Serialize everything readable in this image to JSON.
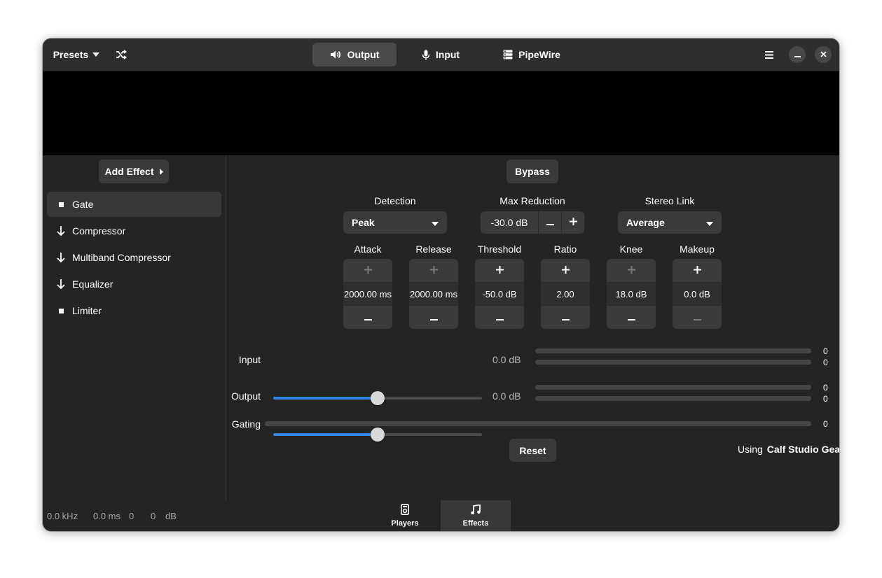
{
  "header": {
    "presets_label": "Presets",
    "tabs": [
      {
        "label": "Output",
        "icon": "speaker-icon",
        "active": true
      },
      {
        "label": "Input",
        "icon": "microphone-icon",
        "active": false
      },
      {
        "label": "PipeWire",
        "icon": "server-icon",
        "active": false
      }
    ]
  },
  "sidebar": {
    "add_effect_label": "Add Effect",
    "effects": [
      {
        "label": "Gate",
        "icon": "square-icon",
        "selected": true
      },
      {
        "label": "Compressor",
        "icon": "arrow-down-icon"
      },
      {
        "label": "Multiband Compressor",
        "icon": "arrow-down-icon"
      },
      {
        "label": "Equalizer",
        "icon": "arrow-down-icon"
      },
      {
        "label": "Limiter",
        "icon": "square-icon"
      }
    ]
  },
  "gate": {
    "bypass_label": "Bypass",
    "detection": {
      "label": "Detection",
      "value": "Peak"
    },
    "max_reduction": {
      "label": "Max Reduction",
      "value": "-30.0 dB"
    },
    "stereo_link": {
      "label": "Stereo Link",
      "value": "Average"
    },
    "controls": [
      {
        "label": "Attack",
        "value": "2000.00 ms",
        "plus_enabled": false,
        "minus_enabled": true
      },
      {
        "label": "Release",
        "value": "2000.00 ms",
        "plus_enabled": false,
        "minus_enabled": true
      },
      {
        "label": "Threshold",
        "value": "-50.0 dB",
        "plus_enabled": true,
        "minus_enabled": true
      },
      {
        "label": "Ratio",
        "value": "2.00",
        "plus_enabled": true,
        "minus_enabled": true
      },
      {
        "label": "Knee",
        "value": "18.0 dB",
        "plus_enabled": false,
        "minus_enabled": true
      },
      {
        "label": "Makeup",
        "value": "0.0 dB",
        "plus_enabled": true,
        "minus_enabled": false
      }
    ],
    "input": {
      "label": "Input",
      "gain": "0.0 dB",
      "slider_fraction": 0.5,
      "levels": [
        "0",
        "0"
      ]
    },
    "output": {
      "label": "Output",
      "gain": "0.0 dB",
      "slider_fraction": 0.5,
      "levels": [
        "0",
        "0"
      ]
    },
    "gating": {
      "label": "Gating",
      "value": "0"
    },
    "reset_label": "Reset",
    "using_prefix": "Using",
    "using_name": "Calf Studio Gear"
  },
  "status": {
    "rate": "0.0 kHz",
    "latency": "0.0 ms",
    "v1": "0",
    "v2": "0",
    "unit": "dB"
  },
  "bottom_tabs": [
    {
      "label": "Players",
      "icon": "media-player-icon",
      "active": false
    },
    {
      "label": "Effects",
      "icon": "music-note-icon",
      "active": true
    }
  ],
  "colors": {
    "accent": "#3584e4",
    "window_bg": "#242424",
    "header_bg": "#2e2e2e",
    "button_bg": "#3a3a3a"
  }
}
